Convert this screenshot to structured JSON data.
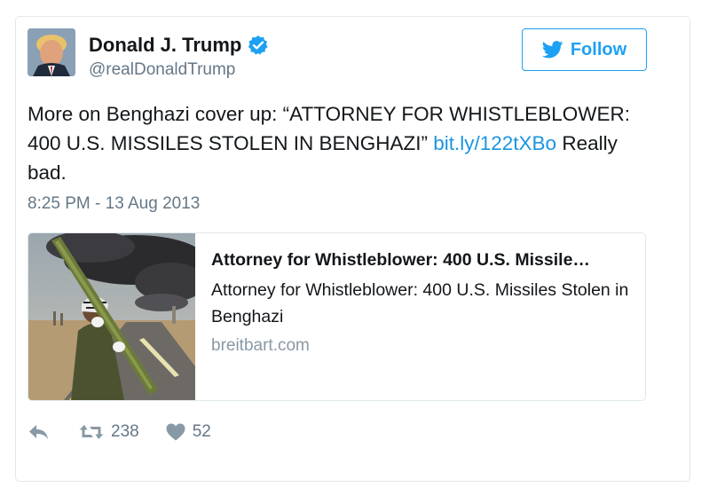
{
  "author": {
    "name": "Donald J. Trump",
    "handle": "@realDonaldTrump",
    "verified": true,
    "avatar_icon": "profile-photo"
  },
  "follow_button": {
    "label": "Follow",
    "icon": "twitter-bird-icon"
  },
  "tweet": {
    "text_before_link": "More on Benghazi cover up: “ATTORNEY FOR WHISTLEBLOWER: 400 U.S. MISSILES STOLEN IN BENGHAZI” ",
    "link_text": "bit.ly/122tXBo",
    "text_after_link": " Really bad.",
    "timestamp": "8:25 PM - 13 Aug 2013"
  },
  "link_card": {
    "title": "Attorney for Whistleblower: 400 U.S. Missile…",
    "description": "Attorney for Whistleblower: 400 U.S. Missiles Stolen in Benghazi",
    "domain": "breitbart.com"
  },
  "actions": {
    "reply_icon": "reply-icon",
    "retweet_count": "238",
    "like_count": "52"
  },
  "colors": {
    "accent": "#1da1f2",
    "link": "#1b95e0",
    "muted": "#657786",
    "border": "#e1e8ed"
  }
}
